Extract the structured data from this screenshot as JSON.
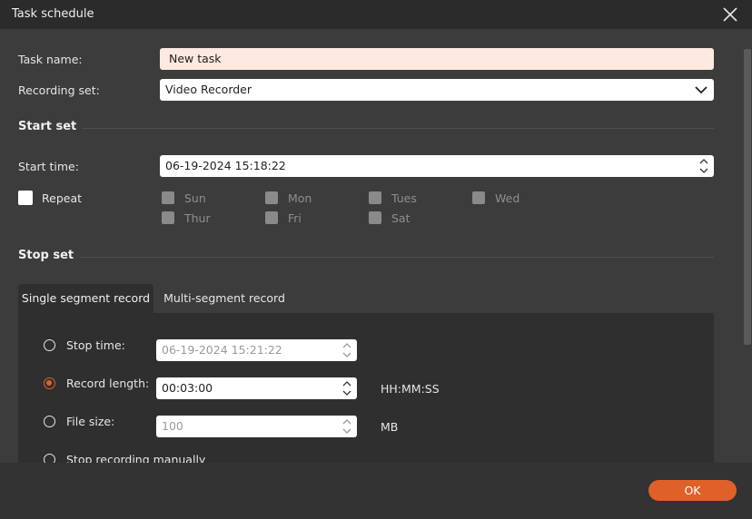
{
  "window": {
    "title": "Task schedule"
  },
  "form": {
    "task_name_label": "Task name:",
    "task_name_value": "New task",
    "recording_set_label": "Recording set:",
    "recording_set_value": "Video Recorder",
    "start_set_heading": "Start set",
    "start_time_label": "Start time:",
    "start_time_value": "06-19-2024 15:18:22",
    "repeat_label": "Repeat",
    "days": [
      "Sun",
      "Mon",
      "Tues",
      "Wed",
      "Thur",
      "Fri",
      "Sat"
    ],
    "stop_set_heading": "Stop set"
  },
  "tabs": {
    "single": "Single segment record",
    "multi": "Multi-segment record"
  },
  "stop_options": {
    "stop_time_label": "Stop time:",
    "stop_time_value": "06-19-2024 15:21:22",
    "record_length_label": "Record length:",
    "record_length_value": "00:03:00",
    "record_length_unit": "HH:MM:SS",
    "file_size_label": "File size:",
    "file_size_value": "100",
    "file_size_unit": "MB",
    "manual_label": "Stop recording manually",
    "selected": "record_length"
  },
  "footer": {
    "ok_label": "OK"
  },
  "colors": {
    "accent": "#e0602a",
    "name_field_bg": "#fde9df"
  },
  "icons": {
    "close": "close-icon",
    "dropdown": "chevron-down-icon",
    "spinner": "spinner-arrows-icon"
  }
}
